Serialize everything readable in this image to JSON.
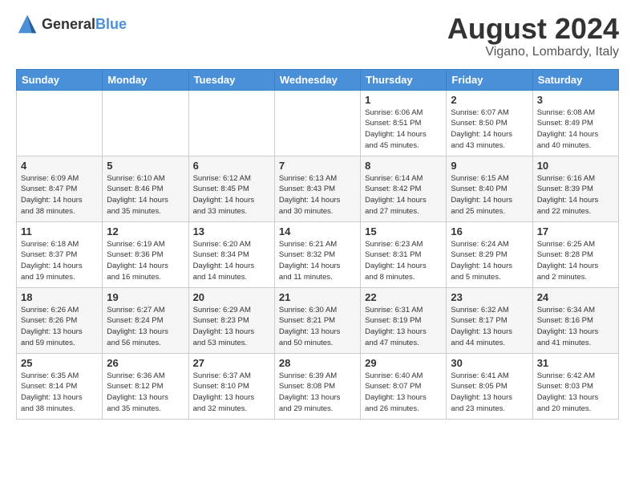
{
  "header": {
    "logo_general": "General",
    "logo_blue": "Blue",
    "month_title": "August 2024",
    "location": "Vigano, Lombardy, Italy"
  },
  "days_of_week": [
    "Sunday",
    "Monday",
    "Tuesday",
    "Wednesday",
    "Thursday",
    "Friday",
    "Saturday"
  ],
  "weeks": [
    [
      {
        "day": "",
        "info": ""
      },
      {
        "day": "",
        "info": ""
      },
      {
        "day": "",
        "info": ""
      },
      {
        "day": "",
        "info": ""
      },
      {
        "day": "1",
        "info": "Sunrise: 6:06 AM\nSunset: 8:51 PM\nDaylight: 14 hours\nand 45 minutes."
      },
      {
        "day": "2",
        "info": "Sunrise: 6:07 AM\nSunset: 8:50 PM\nDaylight: 14 hours\nand 43 minutes."
      },
      {
        "day": "3",
        "info": "Sunrise: 6:08 AM\nSunset: 8:49 PM\nDaylight: 14 hours\nand 40 minutes."
      }
    ],
    [
      {
        "day": "4",
        "info": "Sunrise: 6:09 AM\nSunset: 8:47 PM\nDaylight: 14 hours\nand 38 minutes."
      },
      {
        "day": "5",
        "info": "Sunrise: 6:10 AM\nSunset: 8:46 PM\nDaylight: 14 hours\nand 35 minutes."
      },
      {
        "day": "6",
        "info": "Sunrise: 6:12 AM\nSunset: 8:45 PM\nDaylight: 14 hours\nand 33 minutes."
      },
      {
        "day": "7",
        "info": "Sunrise: 6:13 AM\nSunset: 8:43 PM\nDaylight: 14 hours\nand 30 minutes."
      },
      {
        "day": "8",
        "info": "Sunrise: 6:14 AM\nSunset: 8:42 PM\nDaylight: 14 hours\nand 27 minutes."
      },
      {
        "day": "9",
        "info": "Sunrise: 6:15 AM\nSunset: 8:40 PM\nDaylight: 14 hours\nand 25 minutes."
      },
      {
        "day": "10",
        "info": "Sunrise: 6:16 AM\nSunset: 8:39 PM\nDaylight: 14 hours\nand 22 minutes."
      }
    ],
    [
      {
        "day": "11",
        "info": "Sunrise: 6:18 AM\nSunset: 8:37 PM\nDaylight: 14 hours\nand 19 minutes."
      },
      {
        "day": "12",
        "info": "Sunrise: 6:19 AM\nSunset: 8:36 PM\nDaylight: 14 hours\nand 16 minutes."
      },
      {
        "day": "13",
        "info": "Sunrise: 6:20 AM\nSunset: 8:34 PM\nDaylight: 14 hours\nand 14 minutes."
      },
      {
        "day": "14",
        "info": "Sunrise: 6:21 AM\nSunset: 8:32 PM\nDaylight: 14 hours\nand 11 minutes."
      },
      {
        "day": "15",
        "info": "Sunrise: 6:23 AM\nSunset: 8:31 PM\nDaylight: 14 hours\nand 8 minutes."
      },
      {
        "day": "16",
        "info": "Sunrise: 6:24 AM\nSunset: 8:29 PM\nDaylight: 14 hours\nand 5 minutes."
      },
      {
        "day": "17",
        "info": "Sunrise: 6:25 AM\nSunset: 8:28 PM\nDaylight: 14 hours\nand 2 minutes."
      }
    ],
    [
      {
        "day": "18",
        "info": "Sunrise: 6:26 AM\nSunset: 8:26 PM\nDaylight: 13 hours\nand 59 minutes."
      },
      {
        "day": "19",
        "info": "Sunrise: 6:27 AM\nSunset: 8:24 PM\nDaylight: 13 hours\nand 56 minutes."
      },
      {
        "day": "20",
        "info": "Sunrise: 6:29 AM\nSunset: 8:23 PM\nDaylight: 13 hours\nand 53 minutes."
      },
      {
        "day": "21",
        "info": "Sunrise: 6:30 AM\nSunset: 8:21 PM\nDaylight: 13 hours\nand 50 minutes."
      },
      {
        "day": "22",
        "info": "Sunrise: 6:31 AM\nSunset: 8:19 PM\nDaylight: 13 hours\nand 47 minutes."
      },
      {
        "day": "23",
        "info": "Sunrise: 6:32 AM\nSunset: 8:17 PM\nDaylight: 13 hours\nand 44 minutes."
      },
      {
        "day": "24",
        "info": "Sunrise: 6:34 AM\nSunset: 8:16 PM\nDaylight: 13 hours\nand 41 minutes."
      }
    ],
    [
      {
        "day": "25",
        "info": "Sunrise: 6:35 AM\nSunset: 8:14 PM\nDaylight: 13 hours\nand 38 minutes."
      },
      {
        "day": "26",
        "info": "Sunrise: 6:36 AM\nSunset: 8:12 PM\nDaylight: 13 hours\nand 35 minutes."
      },
      {
        "day": "27",
        "info": "Sunrise: 6:37 AM\nSunset: 8:10 PM\nDaylight: 13 hours\nand 32 minutes."
      },
      {
        "day": "28",
        "info": "Sunrise: 6:39 AM\nSunset: 8:08 PM\nDaylight: 13 hours\nand 29 minutes."
      },
      {
        "day": "29",
        "info": "Sunrise: 6:40 AM\nSunset: 8:07 PM\nDaylight: 13 hours\nand 26 minutes."
      },
      {
        "day": "30",
        "info": "Sunrise: 6:41 AM\nSunset: 8:05 PM\nDaylight: 13 hours\nand 23 minutes."
      },
      {
        "day": "31",
        "info": "Sunrise: 6:42 AM\nSunset: 8:03 PM\nDaylight: 13 hours\nand 20 minutes."
      }
    ]
  ]
}
